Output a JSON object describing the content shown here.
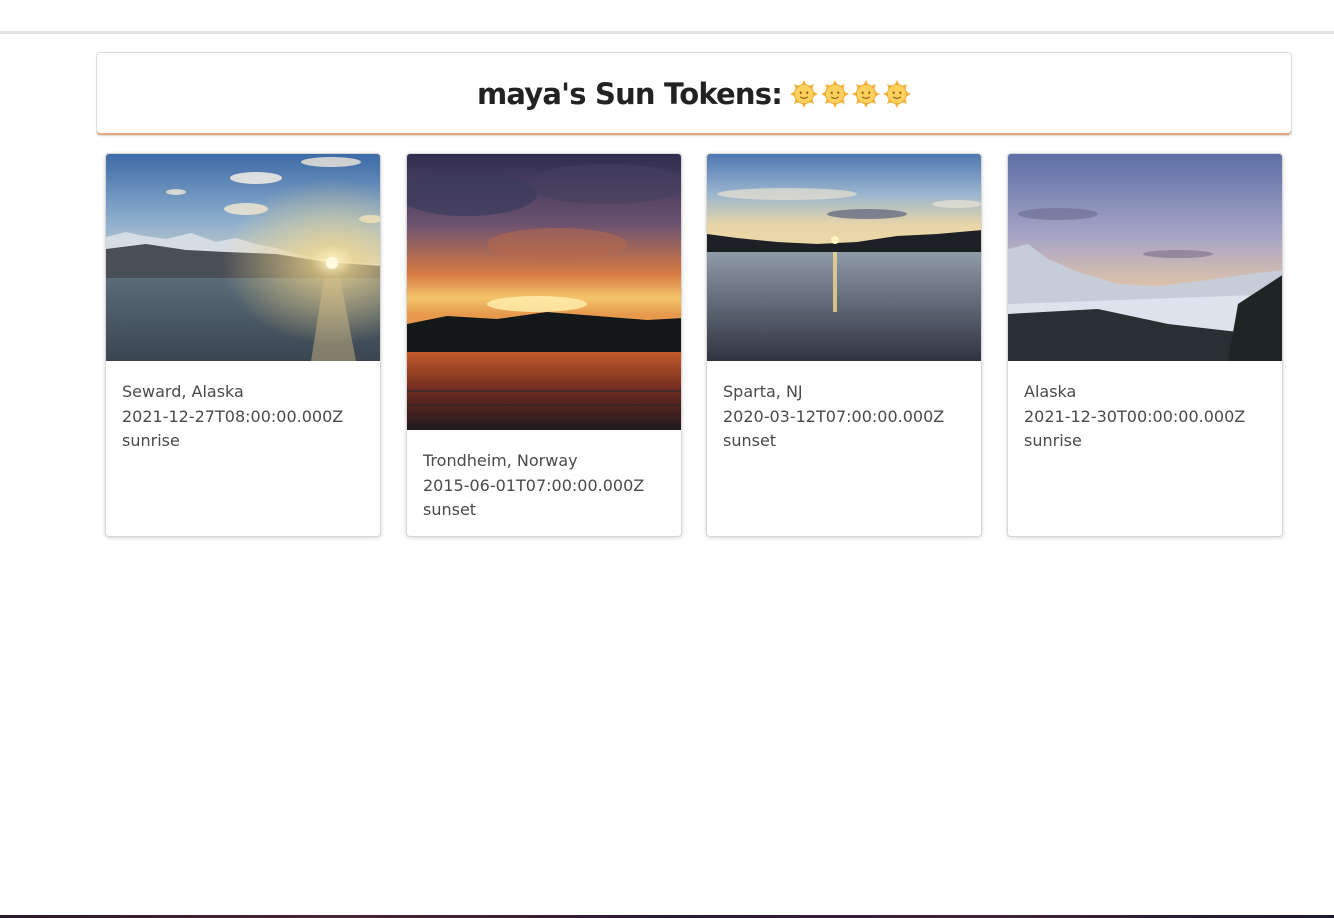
{
  "header": {
    "title": "maya's Sun Tokens:",
    "token_icon": "sun-face-emoji",
    "token_count": 4
  },
  "cards": [
    {
      "location": "Seward, Alaska",
      "date": "2021-12-27T08:00:00.000Z",
      "type": "sunrise"
    },
    {
      "location": "Trondheim, Norway",
      "date": "2015-06-01T07:00:00.000Z",
      "type": "sunset"
    },
    {
      "location": "Sparta, NJ",
      "date": "2020-03-12T07:00:00.000Z",
      "type": "sunset"
    },
    {
      "location": "Alaska",
      "date": "2021-12-30T00:00:00.000Z",
      "type": "sunrise"
    }
  ]
}
